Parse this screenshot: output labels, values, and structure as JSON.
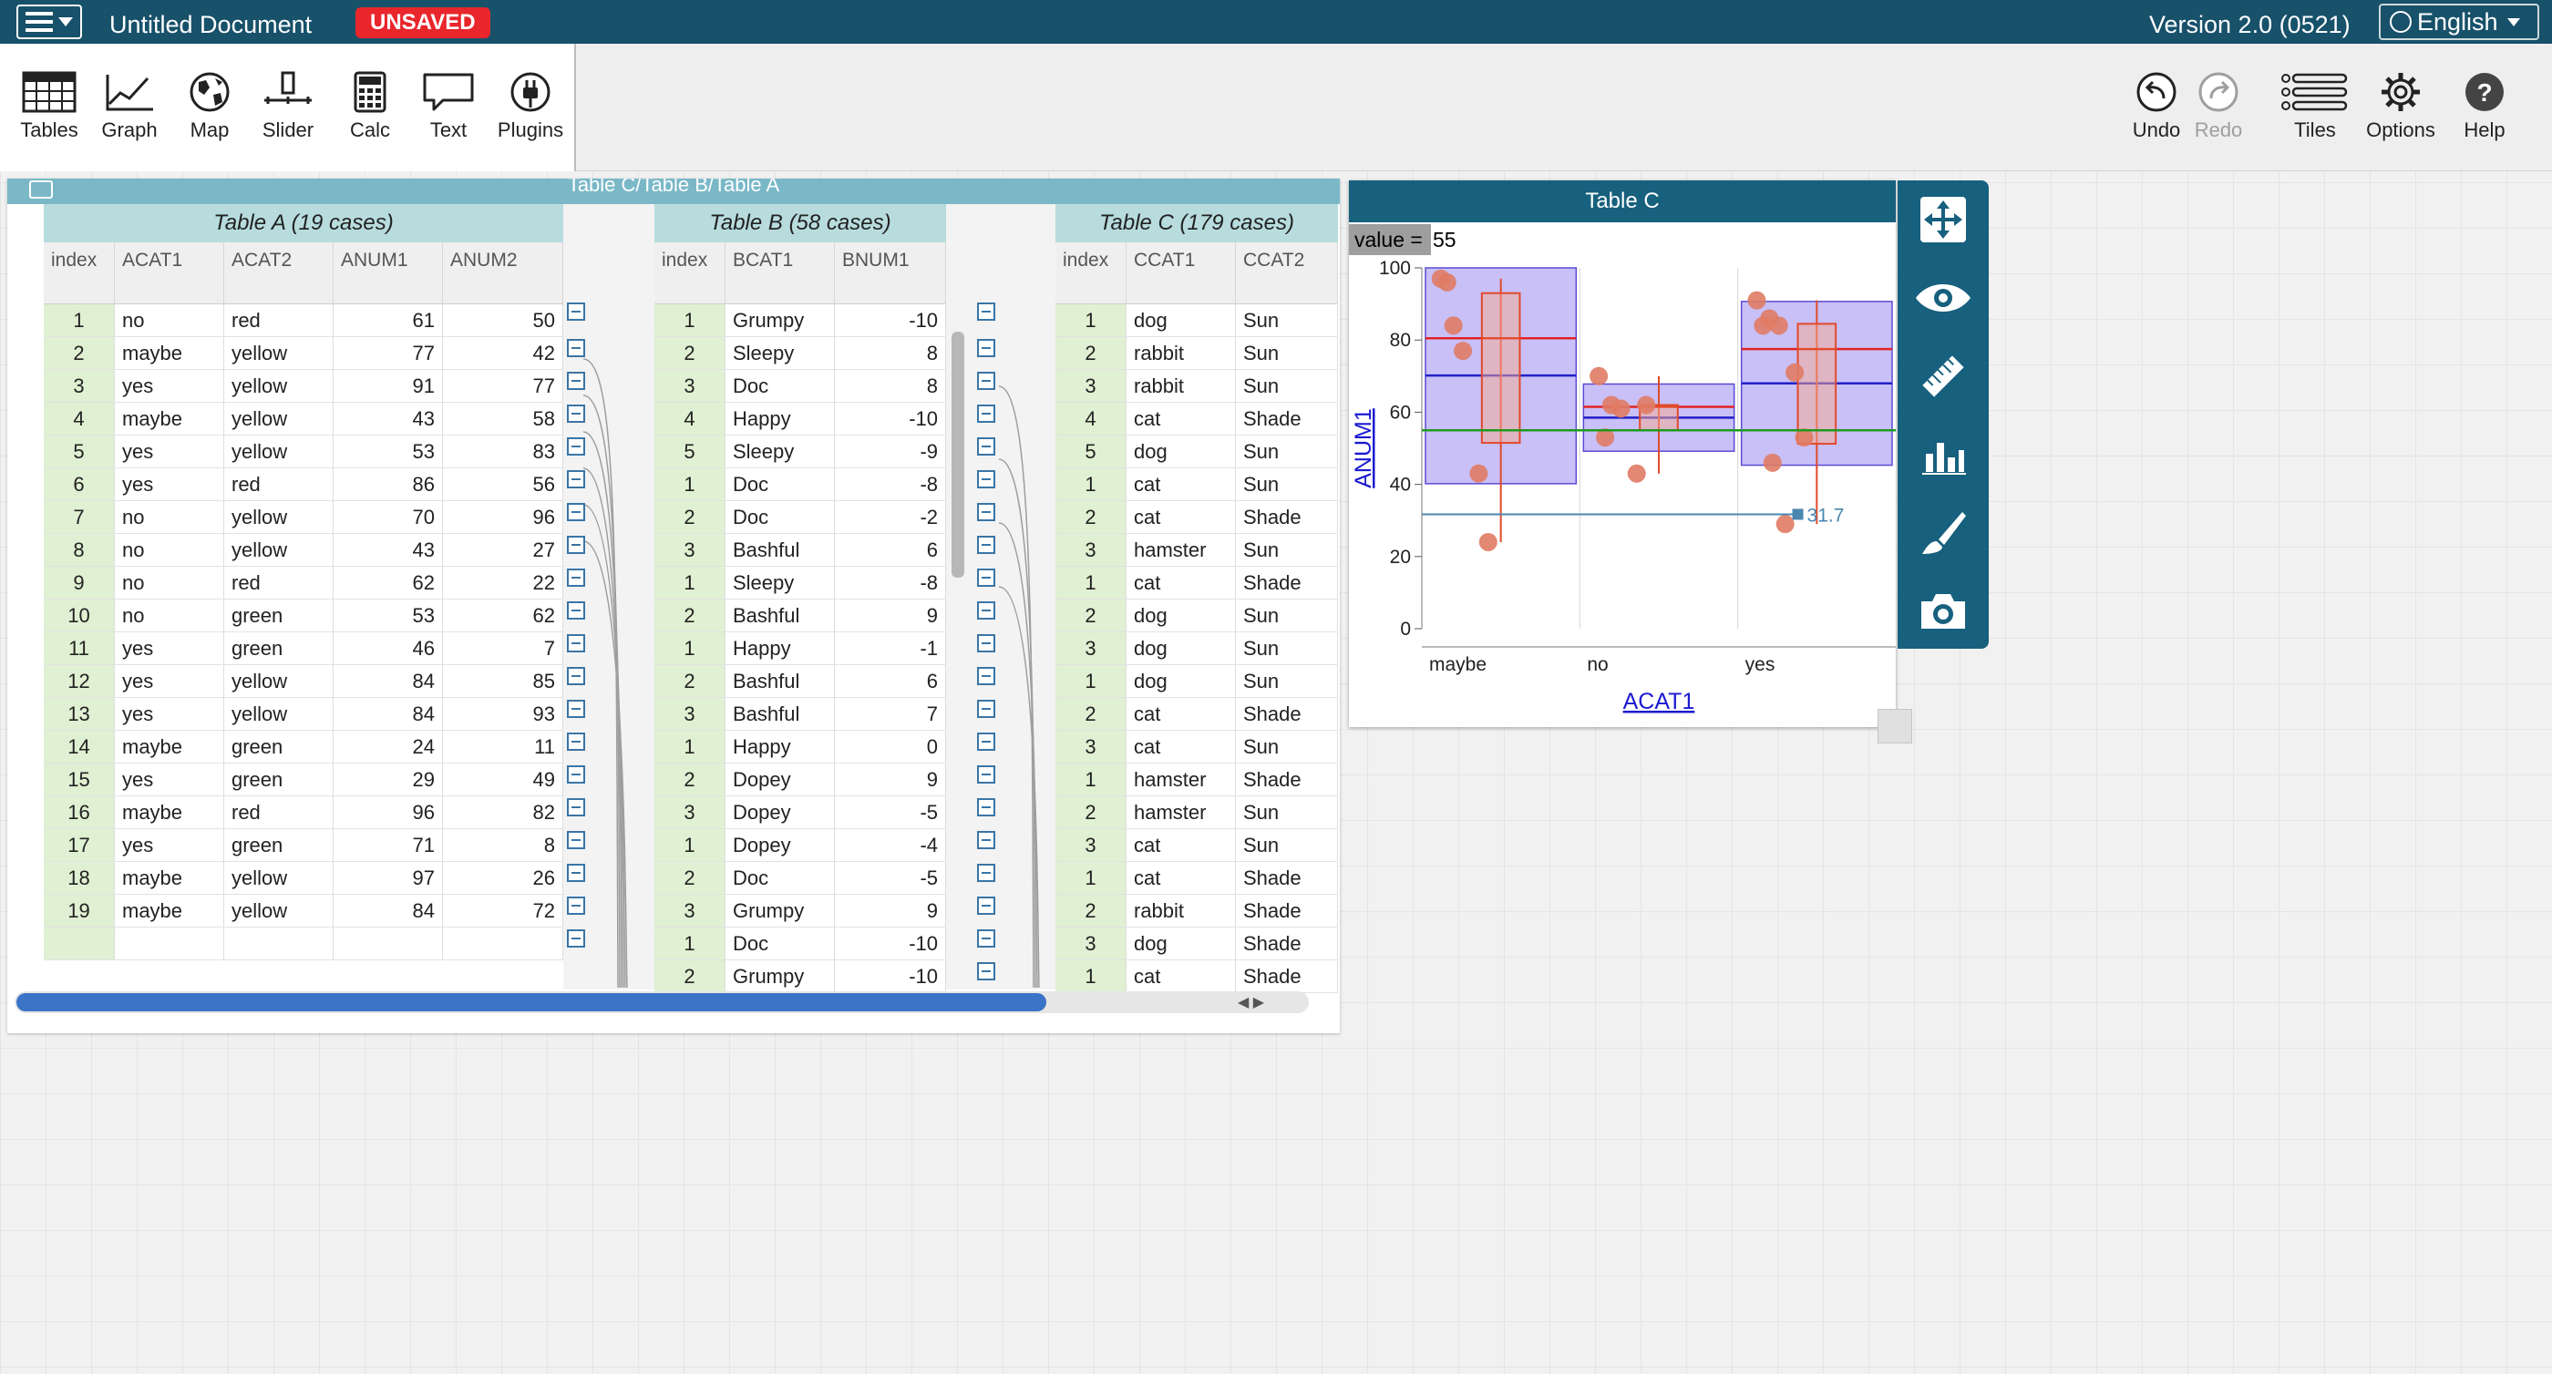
{
  "topbar": {
    "doc_title": "Untitled Document",
    "unsaved_badge": "UNSAVED",
    "version": "Version 2.0 (0521)",
    "language": "English"
  },
  "toolbar": {
    "tools": [
      "Tables",
      "Graph",
      "Map",
      "Slider",
      "Calc",
      "Text",
      "Plugins"
    ],
    "right_tools": [
      "Undo",
      "Redo",
      "Tiles",
      "Options",
      "Help"
    ]
  },
  "table_tile": {
    "title": "Table C/Table B/Table A",
    "table_a": {
      "title": "Table A (19 cases)",
      "columns": [
        "index",
        "ACAT1",
        "ACAT2",
        "ANUM1",
        "ANUM2"
      ],
      "rows": [
        [
          "1",
          "no",
          "red",
          "61",
          "50"
        ],
        [
          "2",
          "maybe",
          "yellow",
          "77",
          "42"
        ],
        [
          "3",
          "yes",
          "yellow",
          "91",
          "77"
        ],
        [
          "4",
          "maybe",
          "yellow",
          "43",
          "58"
        ],
        [
          "5",
          "yes",
          "yellow",
          "53",
          "83"
        ],
        [
          "6",
          "yes",
          "red",
          "86",
          "56"
        ],
        [
          "7",
          "no",
          "yellow",
          "70",
          "96"
        ],
        [
          "8",
          "no",
          "yellow",
          "43",
          "27"
        ],
        [
          "9",
          "no",
          "red",
          "62",
          "22"
        ],
        [
          "10",
          "no",
          "green",
          "53",
          "62"
        ],
        [
          "11",
          "yes",
          "green",
          "46",
          "7"
        ],
        [
          "12",
          "yes",
          "yellow",
          "84",
          "85"
        ],
        [
          "13",
          "yes",
          "yellow",
          "84",
          "93"
        ],
        [
          "14",
          "maybe",
          "green",
          "24",
          "11"
        ],
        [
          "15",
          "yes",
          "green",
          "29",
          "49"
        ],
        [
          "16",
          "maybe",
          "red",
          "96",
          "82"
        ],
        [
          "17",
          "yes",
          "green",
          "71",
          "8"
        ],
        [
          "18",
          "maybe",
          "yellow",
          "97",
          "26"
        ],
        [
          "19",
          "maybe",
          "yellow",
          "84",
          "72"
        ]
      ]
    },
    "table_b": {
      "title": "Table B (58 cases)",
      "columns": [
        "index",
        "BCAT1",
        "BNUM1"
      ],
      "rows": [
        [
          "1",
          "Grumpy",
          "-10"
        ],
        [
          "2",
          "Sleepy",
          "8"
        ],
        [
          "3",
          "Doc",
          "8"
        ],
        [
          "4",
          "Happy",
          "-10"
        ],
        [
          "5",
          "Sleepy",
          "-9"
        ],
        [
          "1",
          "Doc",
          "-8"
        ],
        [
          "2",
          "Doc",
          "-2"
        ],
        [
          "3",
          "Bashful",
          "6"
        ],
        [
          "1",
          "Sleepy",
          "-8"
        ],
        [
          "2",
          "Bashful",
          "9"
        ],
        [
          "1",
          "Happy",
          "-1"
        ],
        [
          "2",
          "Bashful",
          "6"
        ],
        [
          "3",
          "Bashful",
          "7"
        ],
        [
          "1",
          "Happy",
          "0"
        ],
        [
          "2",
          "Dopey",
          "9"
        ],
        [
          "3",
          "Dopey",
          "-5"
        ],
        [
          "1",
          "Dopey",
          "-4"
        ],
        [
          "2",
          "Doc",
          "-5"
        ],
        [
          "3",
          "Grumpy",
          "9"
        ],
        [
          "1",
          "Doc",
          "-10"
        ],
        [
          "2",
          "Grumpy",
          "-10"
        ]
      ]
    },
    "table_c": {
      "title": "Table C (179 cases)",
      "columns": [
        "index",
        "CCAT1",
        "CCAT2"
      ],
      "rows": [
        [
          "1",
          "dog",
          "Sun"
        ],
        [
          "2",
          "rabbit",
          "Sun"
        ],
        [
          "3",
          "rabbit",
          "Sun"
        ],
        [
          "4",
          "cat",
          "Shade"
        ],
        [
          "5",
          "dog",
          "Sun"
        ],
        [
          "1",
          "cat",
          "Sun"
        ],
        [
          "2",
          "cat",
          "Shade"
        ],
        [
          "3",
          "hamster",
          "Sun"
        ],
        [
          "1",
          "cat",
          "Shade"
        ],
        [
          "2",
          "dog",
          "Sun"
        ],
        [
          "3",
          "dog",
          "Sun"
        ],
        [
          "1",
          "dog",
          "Sun"
        ],
        [
          "2",
          "cat",
          "Shade"
        ],
        [
          "3",
          "cat",
          "Sun"
        ],
        [
          "1",
          "hamster",
          "Shade"
        ],
        [
          "2",
          "hamster",
          "Sun"
        ],
        [
          "3",
          "cat",
          "Sun"
        ],
        [
          "1",
          "cat",
          "Shade"
        ],
        [
          "2",
          "rabbit",
          "Shade"
        ],
        [
          "3",
          "dog",
          "Shade"
        ],
        [
          "1",
          "cat",
          "Shade"
        ]
      ]
    }
  },
  "graph": {
    "title": "Table C",
    "value_label": "value =",
    "value": "55",
    "movable_value_label": "31.7",
    "chart_data": {
      "type": "scatter",
      "xlabel": "ACAT1",
      "ylabel": "ANUM1",
      "categories": [
        "maybe",
        "no",
        "yes"
      ],
      "ylim": [
        0,
        100
      ],
      "yticks": [
        0,
        20,
        40,
        60,
        80,
        100
      ],
      "points": {
        "maybe": [
          97,
          84,
          77,
          96,
          43,
          24
        ],
        "no": [
          70,
          62,
          61,
          53,
          43,
          62
        ],
        "yes": [
          91,
          86,
          84,
          84,
          71,
          53,
          46,
          29
        ]
      },
      "movable_value": 55,
      "plotted_value": 31.7
    }
  },
  "colors": {
    "topbar": "#17516a",
    "unsaved": "#e8262b",
    "collection_header": "#b8dcde",
    "index_cell": "#e0f0d2",
    "graph_header": "#17607e",
    "point": "#e07b64",
    "box_fill": "#9b8cf0"
  }
}
